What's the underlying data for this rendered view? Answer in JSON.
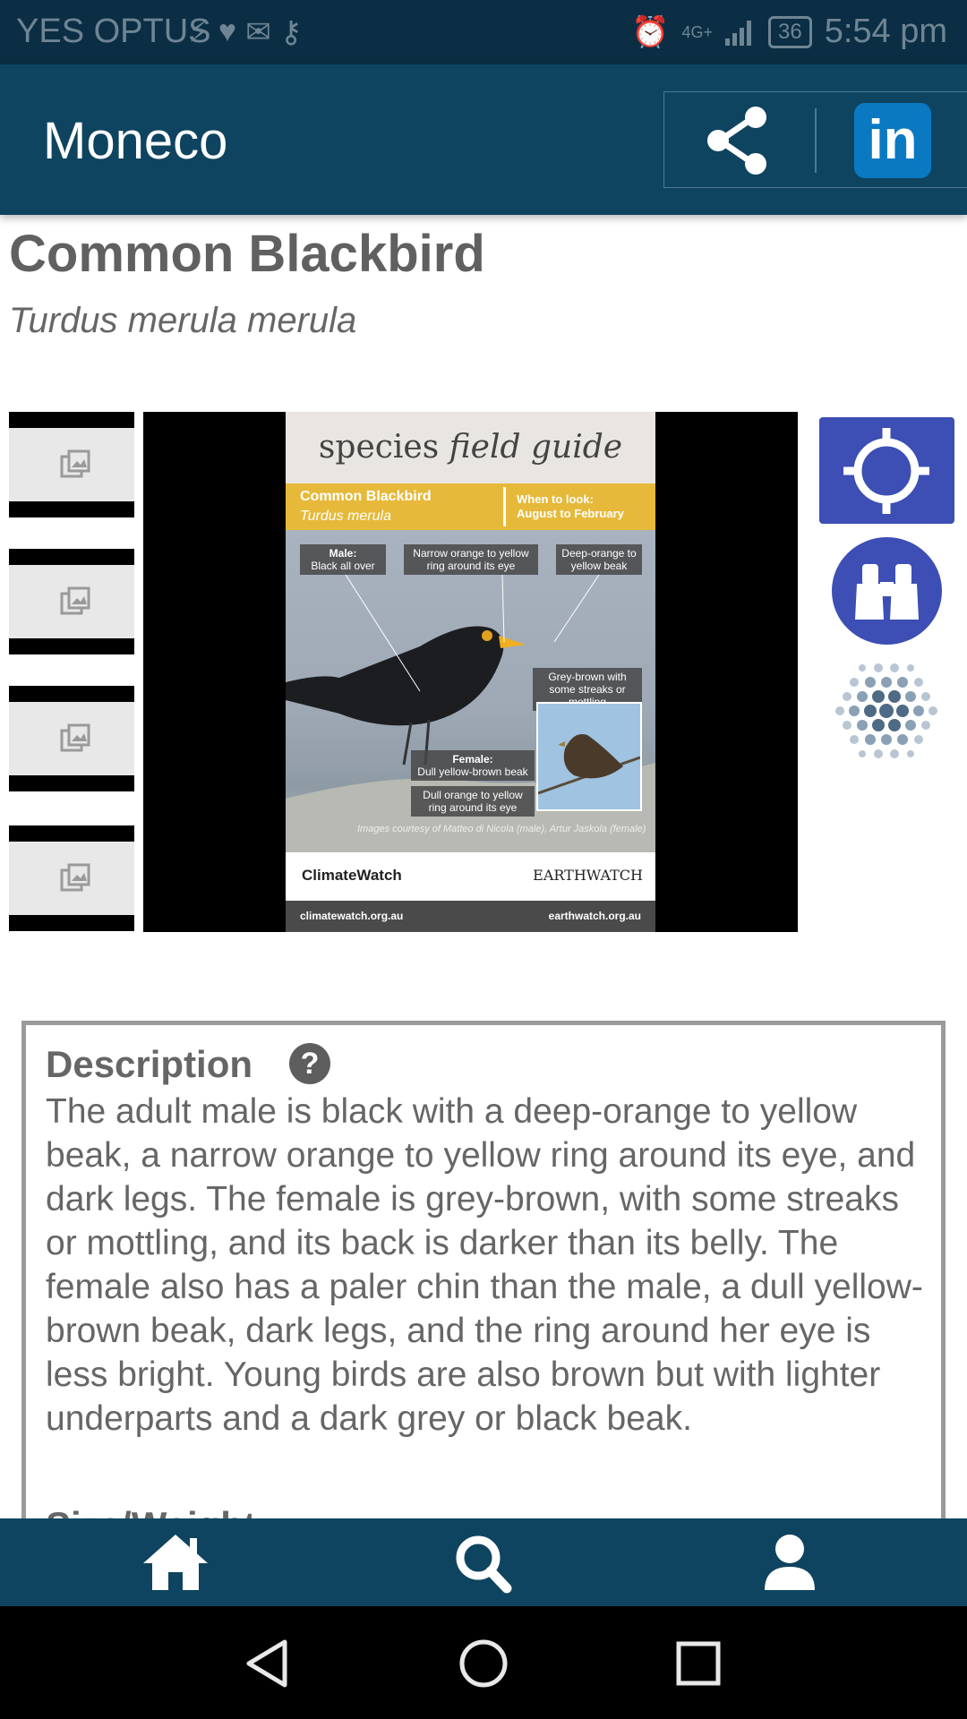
{
  "status_bar": {
    "carrier": "YES OPTUS",
    "network": "4G+",
    "battery": "36",
    "time": "5:54 pm"
  },
  "app_bar": {
    "title": "Moneco",
    "linkedin_label": "in"
  },
  "species": {
    "common_name": "Common Blackbird",
    "scientific_name": "Turdus merula merula"
  },
  "field_guide": {
    "header_plain": "species",
    "header_italic": "field guide",
    "name": "Common Blackbird",
    "scientific": "Turdus merula",
    "when_title": "When to look:",
    "when_value": "August to February",
    "label_male_title": "Male:",
    "label_male": "Black all over",
    "label_ring": "Narrow orange to yellow ring around its eye",
    "label_beak": "Deep-orange to yellow beak",
    "label_grey": "Grey-brown with some streaks or mottling",
    "label_female_title": "Female:",
    "label_female_beak": "Dull yellow-brown beak",
    "label_female_ring": "Dull orange to yellow ring around its eye",
    "credit": "Images courtesy of Matteo di Nicola (male), Artur Jaskola (female)",
    "logo_left": "ClimateWatch",
    "logo_right": "EARTHWATCH",
    "url_left": "climatewatch.org.au",
    "url_right": "earthwatch.org.au"
  },
  "description": {
    "title": "Description",
    "help": "?",
    "text": "The adult male is black with a deep-orange to yellow beak, a narrow orange to yellow ring around its eye, and dark legs. The female is grey-brown, with some streaks or mottling, and its back is darker than its belly. The female also has a paler chin than the male, a dull yellow-brown beak, dark legs, and the ring around her eye is less bright. Young birds are also brown but with lighter underparts and a dark grey or black beak.",
    "next_section": "Size/Weight"
  },
  "icons": {
    "share": "share-icon",
    "linkedin": "linkedin-icon",
    "locate": "crosshair-icon",
    "binoculars": "binoculars-icon",
    "dots": "dots-pattern-icon",
    "home": "home-icon",
    "search": "search-icon",
    "profile": "profile-icon",
    "back": "back-triangle-icon",
    "home_sys": "home-circle-icon",
    "recents": "recents-square-icon"
  },
  "colors": {
    "app_bar": "#0e4460",
    "status_bar": "#0b2e44",
    "accent_button": "#3d4eb4",
    "linkedin": "#0a79c2",
    "guide_band": "#e6b93a"
  }
}
